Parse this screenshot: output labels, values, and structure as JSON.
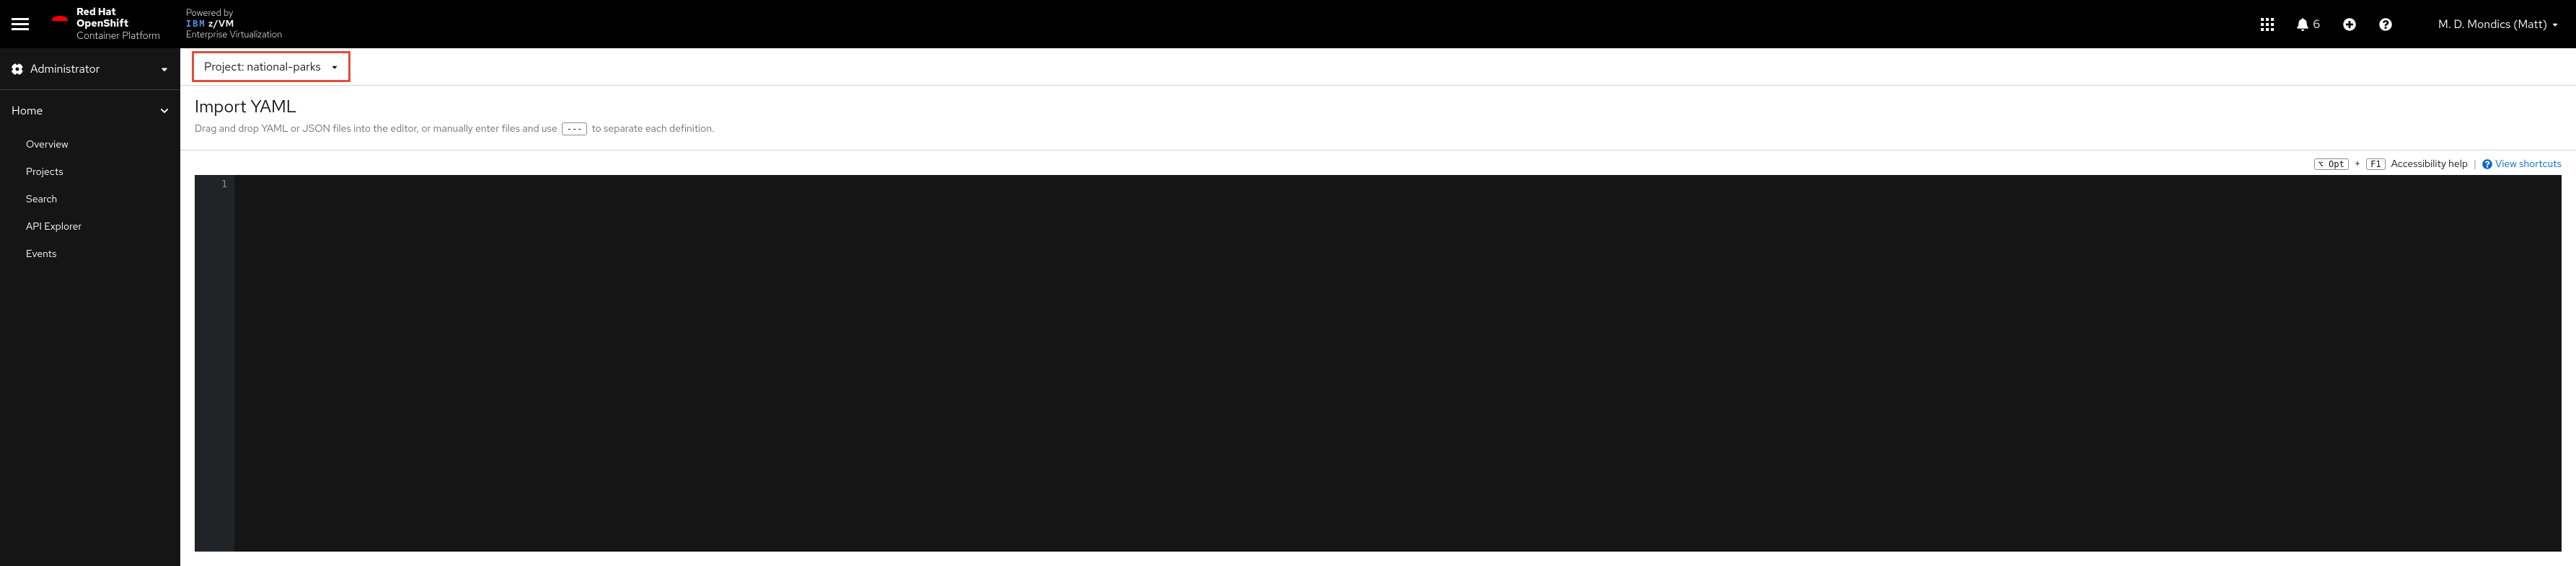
{
  "masthead": {
    "brand_l1": "Red Hat",
    "brand_l2": "OpenShift",
    "brand_l3": "Container Platform",
    "powered_l1": "Powered by",
    "powered_ibm": "IBM",
    "powered_zvm": "z/VM",
    "powered_l3": "Enterprise Virtualization",
    "notif_count": "6",
    "user_name": "M. D. Mondics (Matt)"
  },
  "sidebar": {
    "perspective": "Administrator",
    "section": "Home",
    "items": [
      {
        "label": "Overview"
      },
      {
        "label": "Projects"
      },
      {
        "label": "Search"
      },
      {
        "label": "API Explorer"
      },
      {
        "label": "Events"
      }
    ]
  },
  "project_selector": {
    "label": "Project: national-parks"
  },
  "page": {
    "title": "Import YAML",
    "subtitle_before": "Drag and drop YAML or JSON files into the editor, or manually enter files and use",
    "subtitle_kbd": "---",
    "subtitle_after": "to separate each definition."
  },
  "helpers": {
    "key_opt": "⌥ Opt",
    "plus": "+",
    "key_f1": "F1",
    "accessibility": "Accessibility help",
    "divider": "|",
    "view_shortcuts": "View shortcuts"
  },
  "editor": {
    "line_no": "1",
    "content": ""
  }
}
